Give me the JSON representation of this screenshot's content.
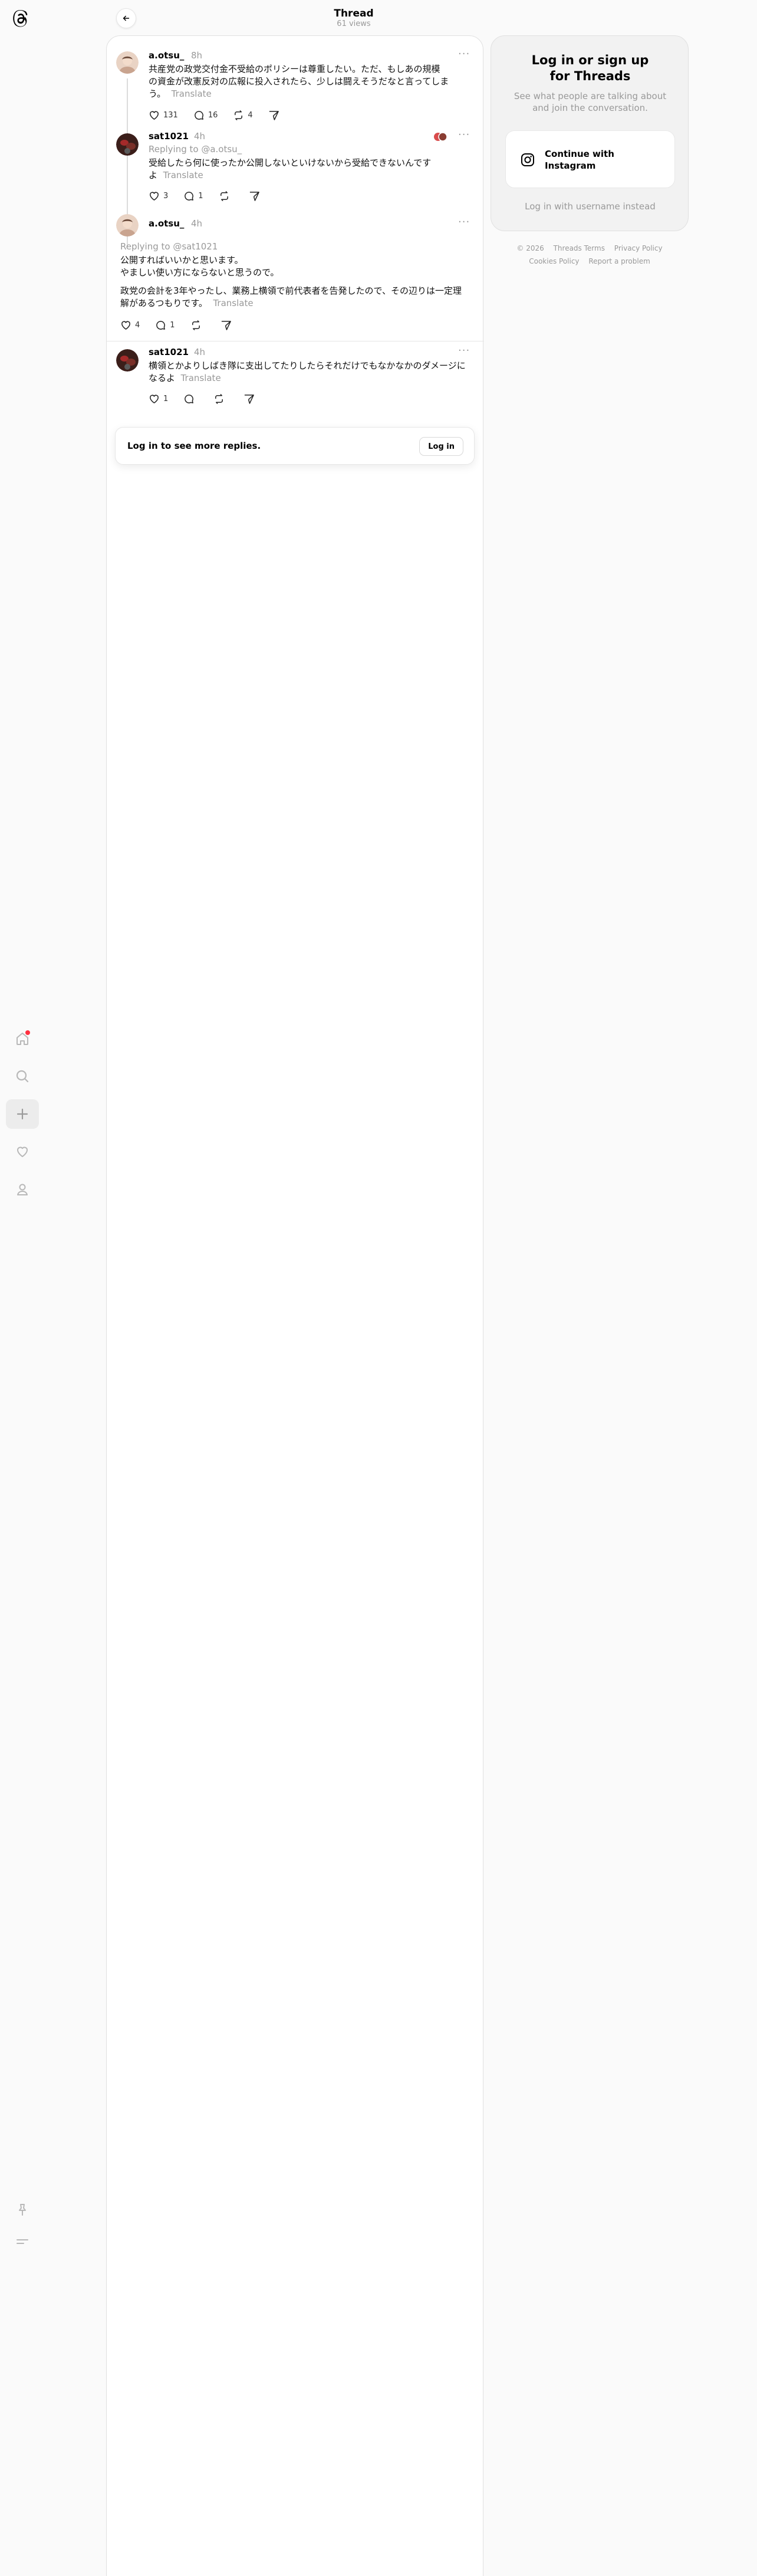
{
  "header": {
    "title": "Thread",
    "subtitle": "61 views"
  },
  "nav": {
    "items": [
      "home-icon",
      "search-icon",
      "create-icon",
      "activity-icon",
      "profile-icon"
    ],
    "bottom": [
      "pin-icon",
      "menu-icon"
    ],
    "notification_dot_color": "#ff3040"
  },
  "posts": [
    {
      "username": "a.otsu_",
      "time": "8h",
      "line1": "共産党の政党交付金不受給のポリシーは尊重したい。ただ、もしあの規模",
      "line2": "の資金が改憲反対の広報に投入されたら、少しは闘えそうだなと言ってしま",
      "line3": "う。",
      "translate": "Translate",
      "likes": "131",
      "replies": "16",
      "reposts": "4"
    },
    {
      "username": "sat1021",
      "time": "4h",
      "reply_to": "Replying to @a.otsu_",
      "line1": "受給したら何に使ったか公開しないといけないから受給できないんです",
      "line2": "よ",
      "translate": "Translate",
      "likes": "3",
      "replies": "1"
    },
    {
      "username": "a.otsu_",
      "time": "4h",
      "reply_to": "Replying to @sat1021",
      "line1": "公開すればいいかと思います。",
      "line2": "やましい使い方にならないと思うので。",
      "line3": "政党の会計を3年やったし、業務上横領で前代表者を告発したので、その辺りは一定理",
      "line4": "解があるつもりです。",
      "translate": "Translate",
      "likes": "4",
      "replies": "1"
    },
    {
      "username": "sat1021",
      "time": "4h",
      "line1": "横領とかよりしばき隊に支出してたりしたらそれだけでもなかなかのダメージに",
      "line2": "なるよ",
      "translate": "Translate",
      "likes": "1"
    }
  ],
  "more_replies": {
    "text": "Log in to see more replies.",
    "button": "Log in"
  },
  "side_panel": {
    "title_line1": "Log in or sign up",
    "title_line2": "for Threads",
    "desc_line1": "See what people are talking about",
    "desc_line2": "and join the conversation.",
    "instagram_line1": "Continue with",
    "instagram_line2": "Instagram",
    "alt_login": "Log in with username instead"
  },
  "footer": {
    "row1": [
      "© 2026",
      "Threads Terms",
      "Privacy Policy"
    ],
    "row2": [
      "Cookies Policy",
      "Report a problem"
    ]
  }
}
